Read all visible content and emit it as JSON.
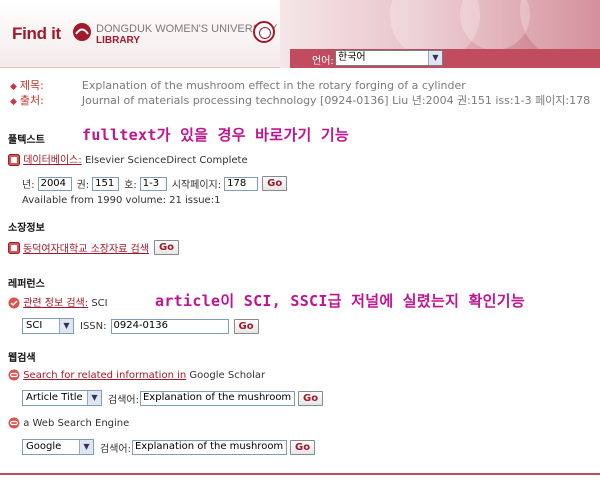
{
  "header": {
    "brand": "Find it",
    "library_line1": "DONGDUK WOMEN'S UNIVERSITY",
    "library_line2": "LIBRARY",
    "language_label": "언어:",
    "language_value": "한국어"
  },
  "citation": {
    "title_key": "제목:",
    "title_value": "Explanation of the mushroom effect in the rotary forging of a cylinder",
    "source_key": "출처:",
    "source_value": "Journal of materials processing technology [0924-0136] Liu 년:2004 권:151 iss:1-3 페이지:178"
  },
  "fulltext": {
    "section_title": "풀텍스트",
    "annotation": "fulltext가 있을 경우 바로가기 기능",
    "db_link": "데이터베이스:",
    "db_name": "Elsevier ScienceDirect Complete",
    "year_label": "년:",
    "year_value": "2004",
    "vol_label": "권:",
    "vol_value": "151",
    "issue_label": "호:",
    "issue_value": "1-3",
    "page_label": "시작페이지:",
    "page_value": "178",
    "go": "Go",
    "available": "Available from 1990 volume: 21 issue:1"
  },
  "holdings": {
    "section_title": "소장정보",
    "link": "동덕여자대학교 소장자료 검색",
    "go": "Go"
  },
  "reference": {
    "section_title": "레퍼런스",
    "annotation": "article이 SCI, SSCI급 저널에 실렸는지 확인기능",
    "link": "관련 정보 검색:",
    "link_suffix": "SCI",
    "select_value": "SCI",
    "issn_label": "ISSN:",
    "issn_value": "0924-0136",
    "go": "Go"
  },
  "websearch": {
    "section_title": "웹검색",
    "scholar_link": "Search for related information in",
    "scholar_name": "Google Scholar",
    "scholar_select": "Article Title",
    "search_label": "검색어:",
    "scholar_query": "Explanation of the mushroom effec",
    "go": "Go",
    "engine_text": "a Web Search Engine",
    "engine_select": "Google",
    "engine_query": "Explanation of the mushroom effec"
  }
}
